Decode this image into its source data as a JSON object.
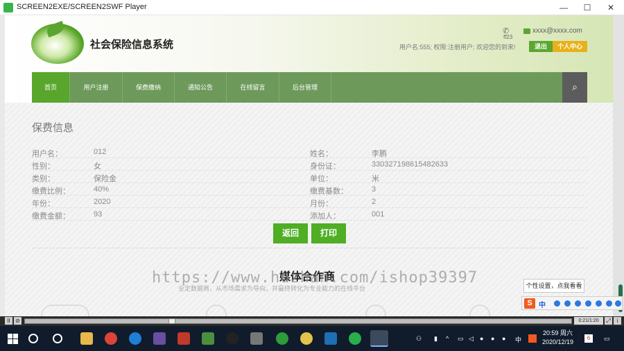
{
  "window": {
    "title": "SCREEN2EXE/SCREEN2SWF Player",
    "min_label": "—",
    "max_label": "☐",
    "close_label": "✕"
  },
  "header": {
    "site_title": "社会保险信息系统",
    "phone_text": "ff23",
    "email": "xxxx@xxxx.com",
    "user_greeting": "用户名:555; 权限:注册用户; 欢迎您的到来!",
    "logout_label": "退出",
    "user_center_label": "个人中心"
  },
  "nav": {
    "items": [
      {
        "label": "首页",
        "active": true
      },
      {
        "label": "用户注册",
        "active": false
      },
      {
        "label": "保费缴纳",
        "active": false
      },
      {
        "label": "通知公告",
        "active": false
      },
      {
        "label": "在线留言",
        "active": false
      },
      {
        "label": "后台管理",
        "active": false
      }
    ],
    "search_icon": "search-icon"
  },
  "section_title": "保费信息",
  "fields": [
    {
      "l1": "用户名：",
      "v1": "012",
      "l2": "姓名：",
      "v2": "李鹏"
    },
    {
      "l1": "性别：",
      "v1": "女",
      "l2": "身份证：",
      "v2": "330327198615482633"
    },
    {
      "l1": "类别：",
      "v1": "保险金",
      "l2": "单位：",
      "v2": "米"
    },
    {
      "l1": "缴费比例：",
      "v1": "40%",
      "l2": "缴费基数：",
      "v2": "3"
    },
    {
      "l1": "年份：",
      "v1": "2020",
      "l2": "月份：",
      "v2": "2"
    },
    {
      "l1": "缴费金额：",
      "v1": "93",
      "l2": "添加人：",
      "v2": "001"
    }
  ],
  "buttons": {
    "back": "返回",
    "print": "打印"
  },
  "media": {
    "title": "媒体合作商",
    "subtitle": "业定数据商，从市场需求为导向，并最终转化为专业能力的在线平台"
  },
  "watermark": "https://www.huzhan.com/ishop39397",
  "ime": {
    "tooltip": "个性设置，点我看看",
    "logo": "S",
    "mode": "中"
  },
  "player": {
    "time": "0:21/1:20",
    "pause": "II",
    "stop": "⊘"
  },
  "taskbar": {
    "time": "20:59 周六",
    "date": "2020/12/19",
    "lang": "中",
    "badge": "6"
  }
}
